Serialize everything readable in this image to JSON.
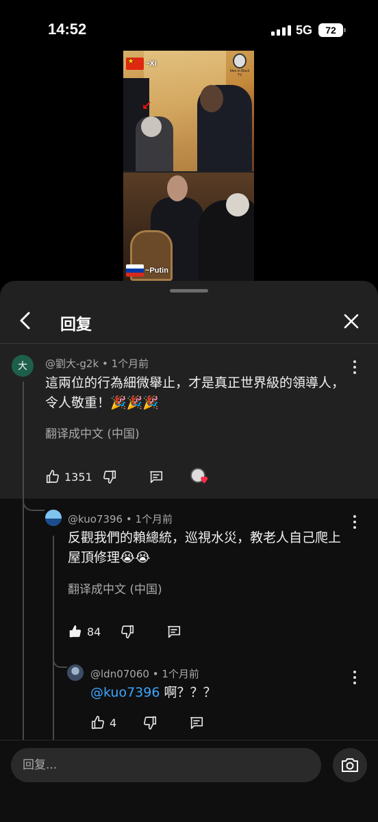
{
  "status_bar": {
    "time": "14:52",
    "network": "5G",
    "battery": "72"
  },
  "video": {
    "label_top": "~Xi",
    "label_bottom": "~Putin",
    "watermark": "Men in Black TV"
  },
  "sheet": {
    "title": "回复"
  },
  "comments": [
    {
      "author": "@劉大-g2k",
      "time": "1个月前",
      "avatar_letter": "大",
      "text": "這兩位的行為細微舉止，才是真正世界級的領導人，令人敬重！🎉🎉🎉",
      "translate": "翻译成中文 (中国)",
      "likes": "1351"
    },
    {
      "author": "@kuo7396",
      "time": "1个月前",
      "text": "反觀我們的賴總統，巡視水災，教老人自己爬上屋頂修理😭😭",
      "translate": "翻译成中文 (中国)",
      "likes": "84"
    },
    {
      "author": "@ldn07060",
      "time": "1个月前",
      "mention": "@kuo7396",
      "text": "啊？？？",
      "likes": "4"
    }
  ],
  "input": {
    "placeholder": "回复..."
  },
  "icons": [
    "back-icon",
    "close-icon",
    "more-icon",
    "like-icon",
    "dislike-icon",
    "reply-icon",
    "camera-icon"
  ]
}
